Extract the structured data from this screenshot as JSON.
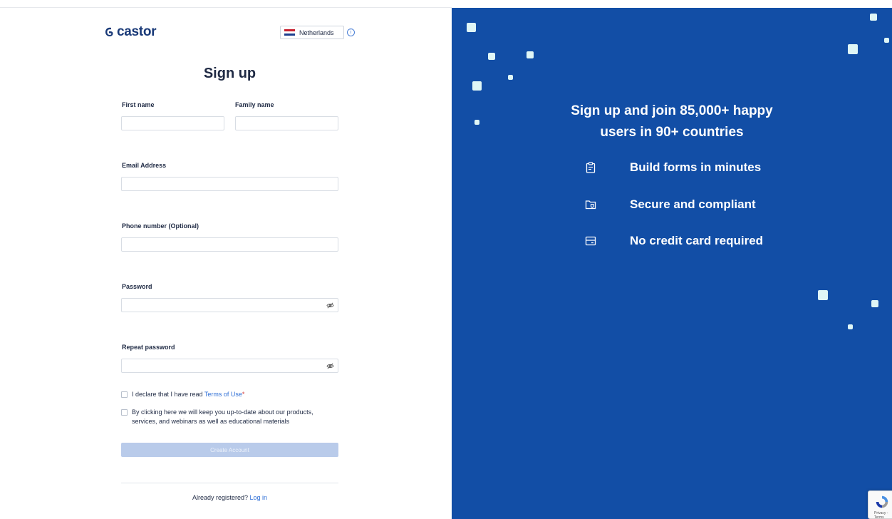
{
  "brand": {
    "name": "castor"
  },
  "language": {
    "selected": "Netherlands"
  },
  "form": {
    "title": "Sign up",
    "first_name_label": "First name",
    "family_name_label": "Family name",
    "email_label": "Email Address",
    "phone_label": "Phone number (Optional)",
    "password_label": "Password",
    "repeat_password_label": "Repeat password",
    "first_name_value": "",
    "family_name_value": "",
    "email_value": "",
    "phone_value": "",
    "password_value": "",
    "repeat_password_value": "",
    "terms_text": "I declare that I have read ",
    "terms_link": "Terms of Use",
    "terms_required": "*",
    "newsletter_line1": "By clicking here we will keep you up-to-date about our products,",
    "newsletter_line2": "services, and webinars as well as educational materials",
    "create_button": "Create Account",
    "already_registered": "Already registered? ",
    "login_link": "Log in"
  },
  "promo": {
    "title_line1": "Sign up and join 85,000+ happy",
    "title_line2": "users in 90+ countries",
    "features": [
      {
        "icon": "clipboard-icon",
        "label": "Build forms in minutes"
      },
      {
        "icon": "folder-shield-icon",
        "label": "Secure and compliant"
      },
      {
        "icon": "credit-card-icon",
        "label": "No credit card required"
      }
    ]
  },
  "recaptcha": {
    "label": "Privacy - Terms"
  },
  "colors": {
    "brand_blue": "#124ea6",
    "link_blue": "#2f6fd6",
    "button_disabled": "#b9cbea",
    "decor_square": "#dff6f6"
  }
}
